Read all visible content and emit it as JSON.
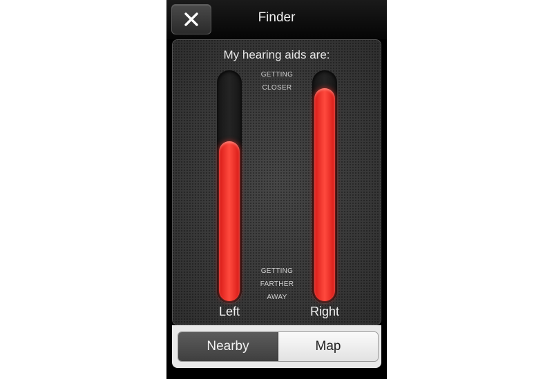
{
  "header": {
    "title": "Finder",
    "close_icon": "close-icon"
  },
  "panel": {
    "title": "My hearing aids are:",
    "hint_top": [
      "GETTING",
      "CLOSER"
    ],
    "hint_bottom": [
      "GETTING",
      "FARTHER",
      "AWAY"
    ],
    "left_label": "Left",
    "right_label": "Right",
    "left_level": 0.7,
    "right_level": 0.93
  },
  "tabs": {
    "nearby_label": "Nearby",
    "map_label": "Map",
    "selected": "Nearby"
  },
  "colors": {
    "meter_fill": "#ff3b30",
    "header_bg": "#0a0a0a"
  }
}
